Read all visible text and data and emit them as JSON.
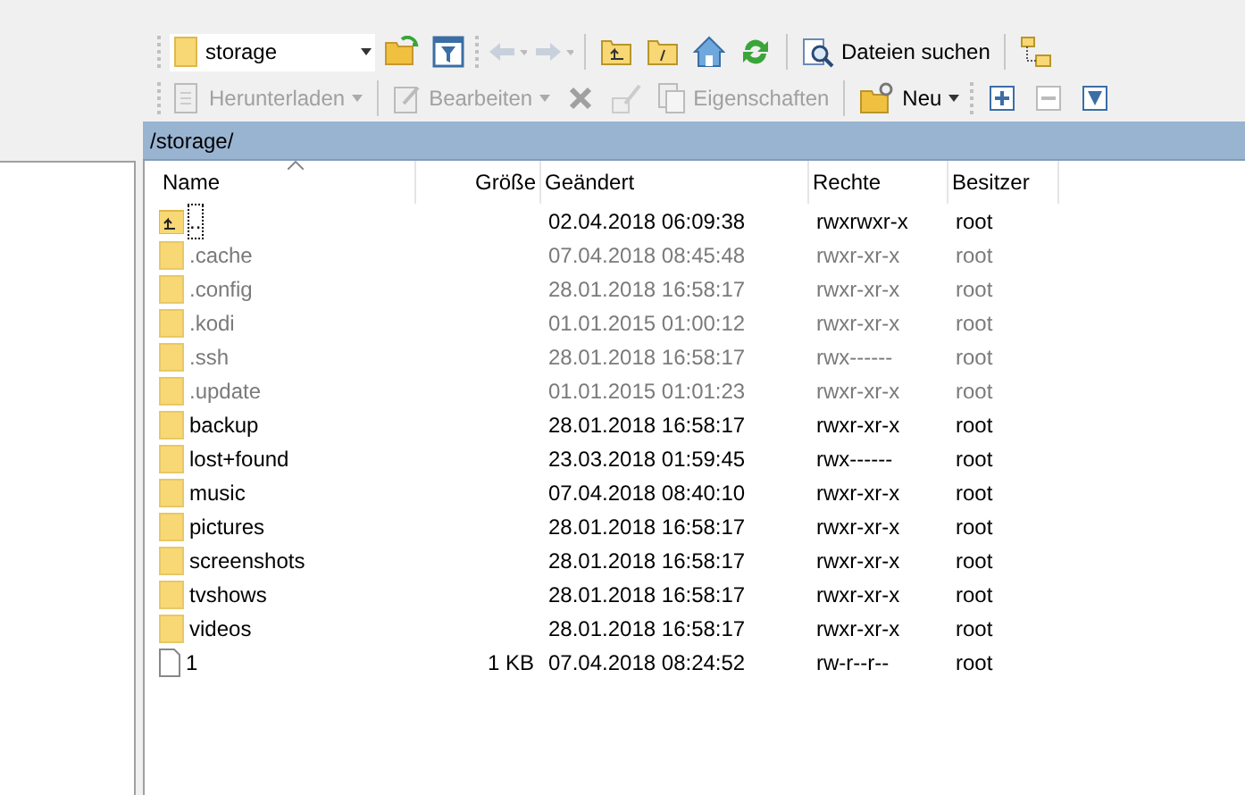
{
  "toolbar_top": {
    "path_combo": {
      "value": "storage"
    },
    "search_button": "Dateien suchen"
  },
  "toolbar_bottom": {
    "download": "Herunterladen",
    "edit": "Bearbeiten",
    "properties": "Eigenschaften",
    "new": "Neu"
  },
  "path_bar": "/storage/",
  "table": {
    "columns": [
      {
        "label": "Name",
        "sorted": true
      },
      {
        "label": "Größe",
        "sorted": false
      },
      {
        "label": "Geändert",
        "sorted": false
      },
      {
        "label": "Rechte",
        "sorted": false
      },
      {
        "label": "Besitzer",
        "sorted": false
      }
    ],
    "rows": [
      {
        "kind": "up",
        "name": "..",
        "modified": "02.04.2018 06:09:38",
        "rights": "rwxrwxr-x",
        "owner": "root",
        "hidden": false
      },
      {
        "kind": "folder",
        "name": ".cache",
        "modified": "07.04.2018 08:45:48",
        "rights": "rwxr-xr-x",
        "owner": "root",
        "hidden": true
      },
      {
        "kind": "folder",
        "name": ".config",
        "modified": "28.01.2018 16:58:17",
        "rights": "rwxr-xr-x",
        "owner": "root",
        "hidden": true
      },
      {
        "kind": "folder",
        "name": ".kodi",
        "modified": "01.01.2015 01:00:12",
        "rights": "rwxr-xr-x",
        "owner": "root",
        "hidden": true
      },
      {
        "kind": "folder",
        "name": ".ssh",
        "modified": "28.01.2018 16:58:17",
        "rights": "rwx------",
        "owner": "root",
        "hidden": true
      },
      {
        "kind": "folder",
        "name": ".update",
        "modified": "01.01.2015 01:01:23",
        "rights": "rwxr-xr-x",
        "owner": "root",
        "hidden": true
      },
      {
        "kind": "folder",
        "name": "backup",
        "modified": "28.01.2018 16:58:17",
        "rights": "rwxr-xr-x",
        "owner": "root",
        "hidden": false
      },
      {
        "kind": "folder",
        "name": "lost+found",
        "modified": "23.03.2018 01:59:45",
        "rights": "rwx------",
        "owner": "root",
        "hidden": false
      },
      {
        "kind": "folder",
        "name": "music",
        "modified": "07.04.2018 08:40:10",
        "rights": "rwxr-xr-x",
        "owner": "root",
        "hidden": false
      },
      {
        "kind": "folder",
        "name": "pictures",
        "modified": "28.01.2018 16:58:17",
        "rights": "rwxr-xr-x",
        "owner": "root",
        "hidden": false
      },
      {
        "kind": "folder",
        "name": "screenshots",
        "modified": "28.01.2018 16:58:17",
        "rights": "rwxr-xr-x",
        "owner": "root",
        "hidden": false
      },
      {
        "kind": "folder",
        "name": "tvshows",
        "modified": "28.01.2018 16:58:17",
        "rights": "rwxr-xr-x",
        "owner": "root",
        "hidden": false
      },
      {
        "kind": "folder",
        "name": "videos",
        "modified": "28.01.2018 16:58:17",
        "rights": "rwxr-xr-x",
        "owner": "root",
        "hidden": false
      },
      {
        "kind": "file",
        "name": "1",
        "size": "1 KB",
        "modified": "07.04.2018 08:24:52",
        "rights": "rw-r--r--",
        "owner": "root",
        "hidden": false
      }
    ]
  }
}
